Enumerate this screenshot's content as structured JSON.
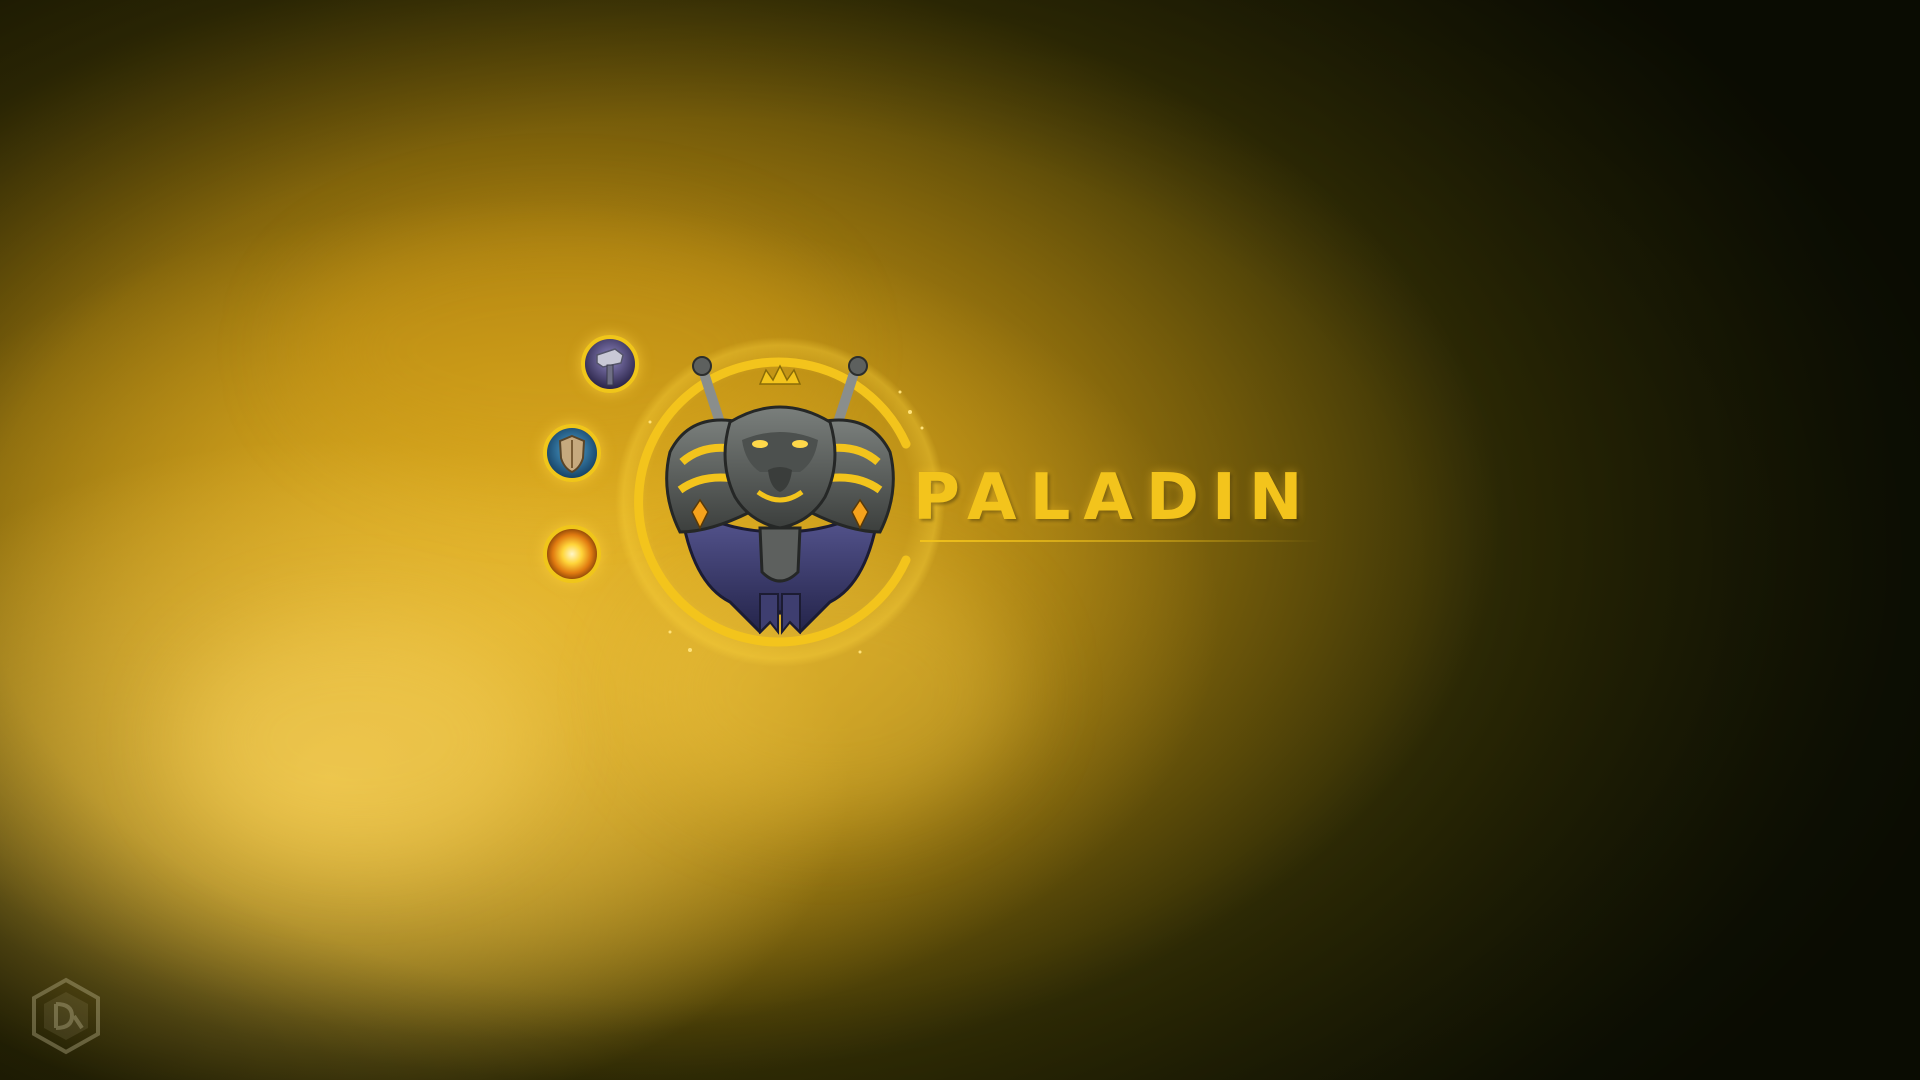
{
  "screen": {
    "class_name": "PALADIN",
    "accent_color": "#f3c41c",
    "background_tint": "#d9a81c"
  },
  "spec_icons": [
    {
      "icon": "hammer-icon",
      "spec": "retribution"
    },
    {
      "icon": "shield-icon",
      "spec": "protection"
    },
    {
      "icon": "holy-light-icon",
      "spec": "holy"
    }
  ],
  "emblem": {
    "icon": "lion-crest-icon"
  },
  "watermark": {
    "icon": "site-logo-icon"
  }
}
